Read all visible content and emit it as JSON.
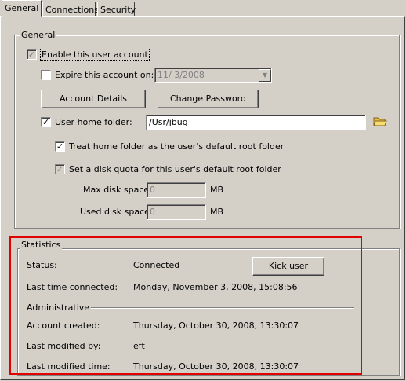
{
  "tabs": [
    {
      "label": "General"
    },
    {
      "label": "Connections"
    },
    {
      "label": "Security"
    }
  ],
  "general": {
    "group_title": "General",
    "enable_account": {
      "label": "Enable this user account",
      "checked": true
    },
    "expire_account": {
      "label": "Expire this account on:",
      "checked": false
    },
    "expire_date": "11/  3/2008",
    "account_details_button": "Account Details",
    "change_password_button": "Change Password",
    "home_folder": {
      "label": "User home folder:",
      "checked": true,
      "value": "/Usr/jbug"
    },
    "treat_home_root": {
      "label": "Treat home folder as the user's default root folder",
      "checked": true
    },
    "disk_quota": {
      "label": "Set a disk quota for this user's default root folder",
      "checked": true
    },
    "max_disk": {
      "label": "Max disk space:",
      "value": "0",
      "unit": "MB"
    },
    "used_disk": {
      "label": "Used disk space:",
      "value": "0",
      "unit": "MB"
    }
  },
  "statistics": {
    "group_title": "Statistics",
    "status_label": "Status:",
    "status_value": "Connected",
    "kick_button": "Kick user",
    "last_connected_label": "Last time connected:",
    "last_connected_value": "Monday, November 3, 2008, 15:08:56",
    "administrative_label": "Administrative",
    "account_created_label": "Account created:",
    "account_created_value": "Thursday, October 30, 2008, 13:30:07",
    "last_modified_by_label": "Last modified by:",
    "last_modified_by_value": "eft",
    "last_modified_time_label": "Last modified time:",
    "last_modified_time_value": "Thursday, October 30, 2008, 13:30:07"
  },
  "icons": {
    "folder": "folder-icon"
  },
  "colors": {
    "face": "#d4d0c8",
    "highlight": "#e00000",
    "folder": "#e8c040"
  }
}
